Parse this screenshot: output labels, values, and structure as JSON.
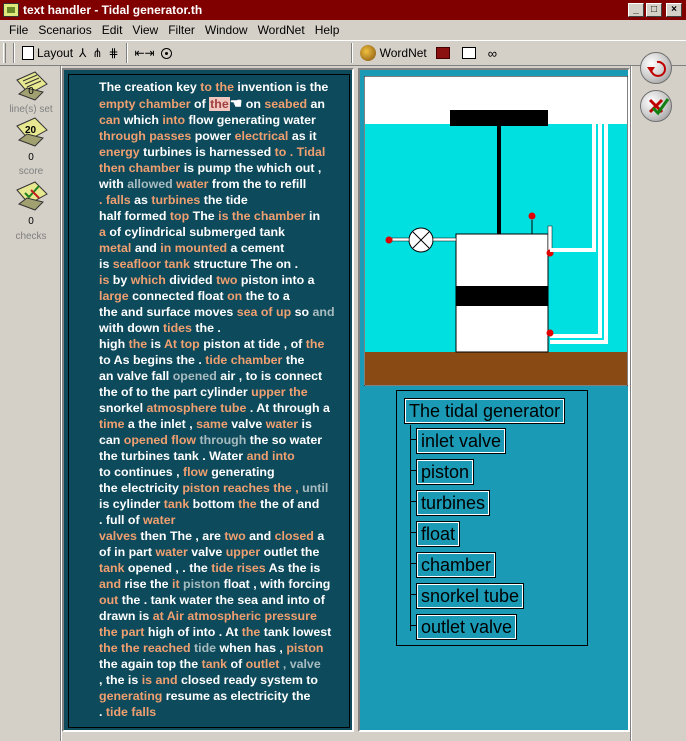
{
  "window": {
    "title": "text handler - Tidal generator.th",
    "minimize": "_",
    "maximize": "□",
    "close": "×"
  },
  "menu": [
    "File",
    "Scenarios",
    "Edit",
    "View",
    "Filter",
    "Window",
    "WordNet",
    "Help"
  ],
  "toolbar": {
    "layout_label": "Layout",
    "wordnet_label": "WordNet"
  },
  "sidebar": {
    "lines_set": {
      "value": "0",
      "label": "line(s) set"
    },
    "score": {
      "value": "0",
      "label": "score"
    },
    "checks": {
      "value": "0",
      "label": "checks"
    }
  },
  "text_lines": [
    [
      [
        "The creation key ",
        "n"
      ],
      [
        "to the ",
        "o"
      ],
      [
        "invention is the",
        "n"
      ]
    ],
    [
      [
        "empty chamber ",
        "o"
      ],
      [
        "of ",
        "n"
      ],
      [
        "the",
        "hl"
      ],
      [
        " on ",
        "n"
      ],
      [
        "seabed ",
        "o"
      ],
      [
        "an",
        "n"
      ]
    ],
    [
      [
        "can ",
        "o"
      ],
      [
        "which ",
        "n"
      ],
      [
        "into ",
        "o"
      ],
      [
        "flow ",
        "n"
      ],
      [
        "generating water",
        "n"
      ]
    ],
    [
      [
        "through ",
        "o"
      ],
      [
        "passes ",
        "o"
      ],
      [
        "power ",
        "n"
      ],
      [
        "electrical ",
        "o"
      ],
      [
        "as it",
        "n"
      ]
    ],
    [
      [
        "energy ",
        "o"
      ],
      [
        "turbines is harnessed ",
        "n"
      ],
      [
        "to . Tidal",
        "o"
      ]
    ],
    [
      [
        "then chamber ",
        "o"
      ],
      [
        "is pump the which out ,",
        "n"
      ]
    ],
    [
      [
        "with ",
        "n"
      ],
      [
        "allowed ",
        "g"
      ],
      [
        "water ",
        "o"
      ],
      [
        "from the to refill",
        "n"
      ]
    ],
    [
      [
        ". falls ",
        "o"
      ],
      [
        "as ",
        "n"
      ],
      [
        "turbines ",
        "o"
      ],
      [
        "the tide",
        "n"
      ]
    ],
    [
      [
        "half formed ",
        "n"
      ],
      [
        "top ",
        "o"
      ],
      [
        "The ",
        "n"
      ],
      [
        "is the chamber ",
        "o"
      ],
      [
        "in",
        "n"
      ]
    ],
    [
      [
        "a ",
        "o"
      ],
      [
        "of cylindrical submerged tank",
        "n"
      ]
    ],
    [
      [
        "metal ",
        "o"
      ],
      [
        "and ",
        "n"
      ],
      [
        "in mounted ",
        "o"
      ],
      [
        "a cement",
        "n"
      ]
    ],
    [
      [
        "is ",
        "n"
      ],
      [
        "seafloor tank ",
        "o"
      ],
      [
        "structure ",
        "n"
      ],
      [
        "The on .",
        "n"
      ]
    ],
    [
      [
        "is ",
        "o"
      ],
      [
        "by ",
        "n"
      ],
      [
        "which ",
        "o"
      ],
      [
        "divided ",
        "n"
      ],
      [
        "two ",
        "o"
      ],
      [
        "piston into a",
        "n"
      ]
    ],
    [
      [
        "large ",
        "o"
      ],
      [
        "connected float ",
        "n"
      ],
      [
        "on ",
        "o"
      ],
      [
        "the to a",
        "n"
      ]
    ],
    [
      [
        "the and surface moves ",
        "n"
      ],
      [
        "sea ",
        "o"
      ],
      [
        "of up ",
        "o"
      ],
      [
        "so ",
        "n"
      ],
      [
        "and",
        "g"
      ]
    ],
    [
      [
        "with down ",
        "n"
      ],
      [
        "tides ",
        "o"
      ],
      [
        "the .",
        "n"
      ]
    ],
    [
      [
        "high ",
        "n"
      ],
      [
        "the ",
        "o"
      ],
      [
        "is ",
        "n"
      ],
      [
        "At top ",
        "o"
      ],
      [
        "piston at tide , of ",
        "n"
      ],
      [
        "the",
        "o"
      ]
    ],
    [
      [
        "to As begins the . ",
        "n"
      ],
      [
        "tide chamber ",
        "o"
      ],
      [
        "the",
        "n"
      ]
    ],
    [
      [
        "an valve fall ",
        "n"
      ],
      [
        "opened ",
        "g"
      ],
      [
        "air , to is connect",
        "n"
      ]
    ],
    [
      [
        "the of to the part cylinder ",
        "n"
      ],
      [
        "upper the",
        "o"
      ]
    ],
    [
      [
        "snorkel ",
        "n"
      ],
      [
        "atmosphere tube ",
        "o"
      ],
      [
        ". At through a",
        "n"
      ]
    ],
    [
      [
        "time ",
        "o"
      ],
      [
        "a the inlet , ",
        "n"
      ],
      [
        "same ",
        "o"
      ],
      [
        "valve ",
        "n"
      ],
      [
        "water ",
        "o"
      ],
      [
        "is",
        "n"
      ]
    ],
    [
      [
        "can ",
        "n"
      ],
      [
        "opened flow ",
        "o"
      ],
      [
        "through ",
        "g"
      ],
      [
        "the so water",
        "n"
      ]
    ],
    [
      [
        "the turbines tank . Water ",
        "n"
      ],
      [
        "and into",
        "o"
      ]
    ],
    [
      [
        "to continues , ",
        "n"
      ],
      [
        "flow ",
        "o"
      ],
      [
        "generating",
        "n"
      ]
    ],
    [
      [
        "the electricity ",
        "n"
      ],
      [
        "piston reaches the , ",
        "o"
      ],
      [
        "until",
        "g"
      ]
    ],
    [
      [
        "is cylinder ",
        "n"
      ],
      [
        "tank ",
        "o"
      ],
      [
        "bottom ",
        "n"
      ],
      [
        "the ",
        "o"
      ],
      [
        "the of and",
        "n"
      ]
    ],
    [
      [
        ". full of ",
        "n"
      ],
      [
        "water",
        "o"
      ]
    ],
    [
      [
        "valves ",
        "o"
      ],
      [
        "then The , are ",
        "n"
      ],
      [
        "two ",
        "o"
      ],
      [
        "and ",
        "n"
      ],
      [
        "closed ",
        "o"
      ],
      [
        "a",
        "n"
      ]
    ],
    [
      [
        "of in part ",
        "n"
      ],
      [
        "water ",
        "o"
      ],
      [
        "valve ",
        "n"
      ],
      [
        "upper ",
        "o"
      ],
      [
        "outlet the",
        "n"
      ]
    ],
    [
      [
        "tank ",
        "o"
      ],
      [
        "opened , . the ",
        "n"
      ],
      [
        "tide rises ",
        "o"
      ],
      [
        "As the is",
        "n"
      ]
    ],
    [
      [
        "and ",
        "o"
      ],
      [
        "rise the ",
        "n"
      ],
      [
        "it ",
        "o"
      ],
      [
        "piston ",
        "g"
      ],
      [
        "float , with forcing",
        "n"
      ]
    ],
    [
      [
        "out ",
        "o"
      ],
      [
        "the . tank water the sea and into of",
        "n"
      ]
    ],
    [
      [
        "drawn is ",
        "n"
      ],
      [
        "at ",
        "o"
      ],
      [
        "Air atmospheric pressure",
        "o"
      ]
    ],
    [
      [
        "the part ",
        "o"
      ],
      [
        "high ",
        "n"
      ],
      [
        "of into . At ",
        "n"
      ],
      [
        "the ",
        "o"
      ],
      [
        "tank lowest",
        "n"
      ]
    ],
    [
      [
        "the the reached ",
        "o"
      ],
      [
        "tide ",
        "g"
      ],
      [
        "when has , ",
        "n"
      ],
      [
        "piston",
        "o"
      ]
    ],
    [
      [
        "the again top the ",
        "n"
      ],
      [
        "tank ",
        "o"
      ],
      [
        "of ",
        "n"
      ],
      [
        "outlet ",
        "o"
      ],
      [
        ", valve",
        "g"
      ]
    ],
    [
      [
        ", the is ",
        "n"
      ],
      [
        "is and ",
        "o"
      ],
      [
        "closed ready system to",
        "n"
      ]
    ],
    [
      [
        "generating ",
        "o"
      ],
      [
        "resume as electricity the",
        "n"
      ]
    ],
    [
      [
        ". ",
        "n"
      ],
      [
        "tide falls",
        "o"
      ]
    ]
  ],
  "diagram": {
    "title": "The tidal generator",
    "labels": [
      "inlet valve",
      "piston",
      "turbines",
      "float",
      "chamber",
      "snorkel tube",
      "outlet valve"
    ]
  },
  "colors": {
    "titlebar": "#800000",
    "text_background": "#0d4a5c",
    "diagram_background": "#1b9ab5",
    "water": "#00e0e0",
    "seabed": "#8a4a14",
    "highlight_word": "#f0a070"
  }
}
